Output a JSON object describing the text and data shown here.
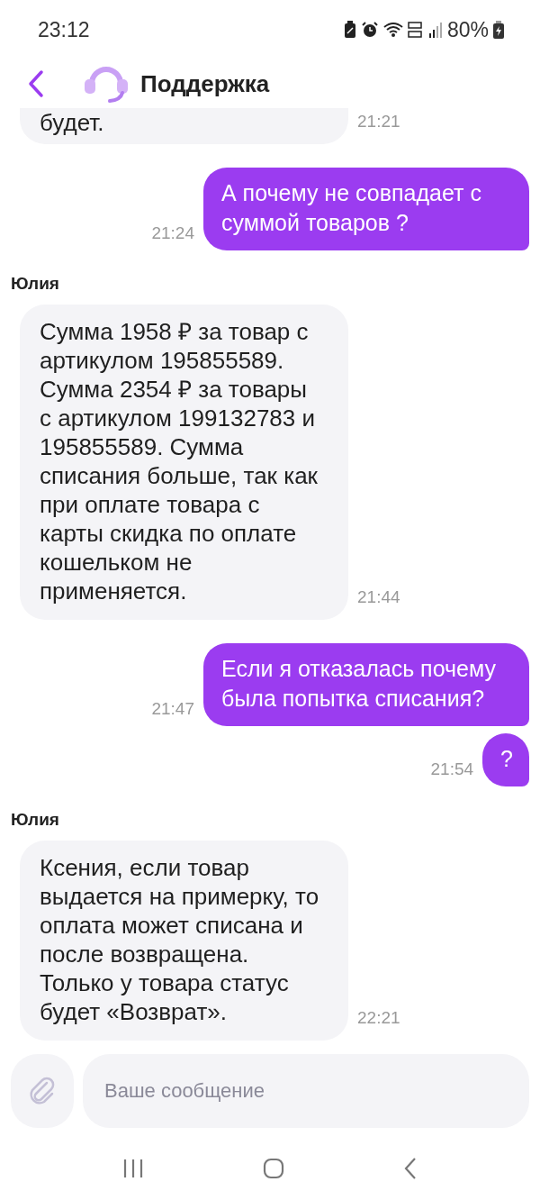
{
  "status_bar": {
    "time": "23:12",
    "battery": "80%"
  },
  "header": {
    "title": "Поддержка"
  },
  "messages": [
    {
      "kind": "incoming",
      "text": "будет.",
      "time": "21:21"
    },
    {
      "kind": "outgoing",
      "text": "А почему не совпадает с суммой товаров ?",
      "time": "21:24"
    },
    {
      "kind": "incoming",
      "author": "Юлия",
      "text": "Сумма 1958 ₽ за товар с артикулом 195855589. Сумма 2354 ₽ за товары с артикулом 199132783 и 195855589. Сумма списания больше, так как при оплате товара с карты скидка по оплате кошельком не применяется.",
      "time": "21:44"
    },
    {
      "kind": "outgoing",
      "text": "Если я отказалась почему была попытка списания?",
      "time": "21:47"
    },
    {
      "kind": "outgoing",
      "text": "?",
      "time": "21:54"
    },
    {
      "kind": "incoming",
      "author": "Юлия",
      "text": "Ксения, если товар выдается на примерку, то оплата может списана и после возвращена. Только у товара статус будет «Возврат».",
      "time": "22:21"
    }
  ],
  "composer": {
    "placeholder": "Ваше сообщение"
  }
}
